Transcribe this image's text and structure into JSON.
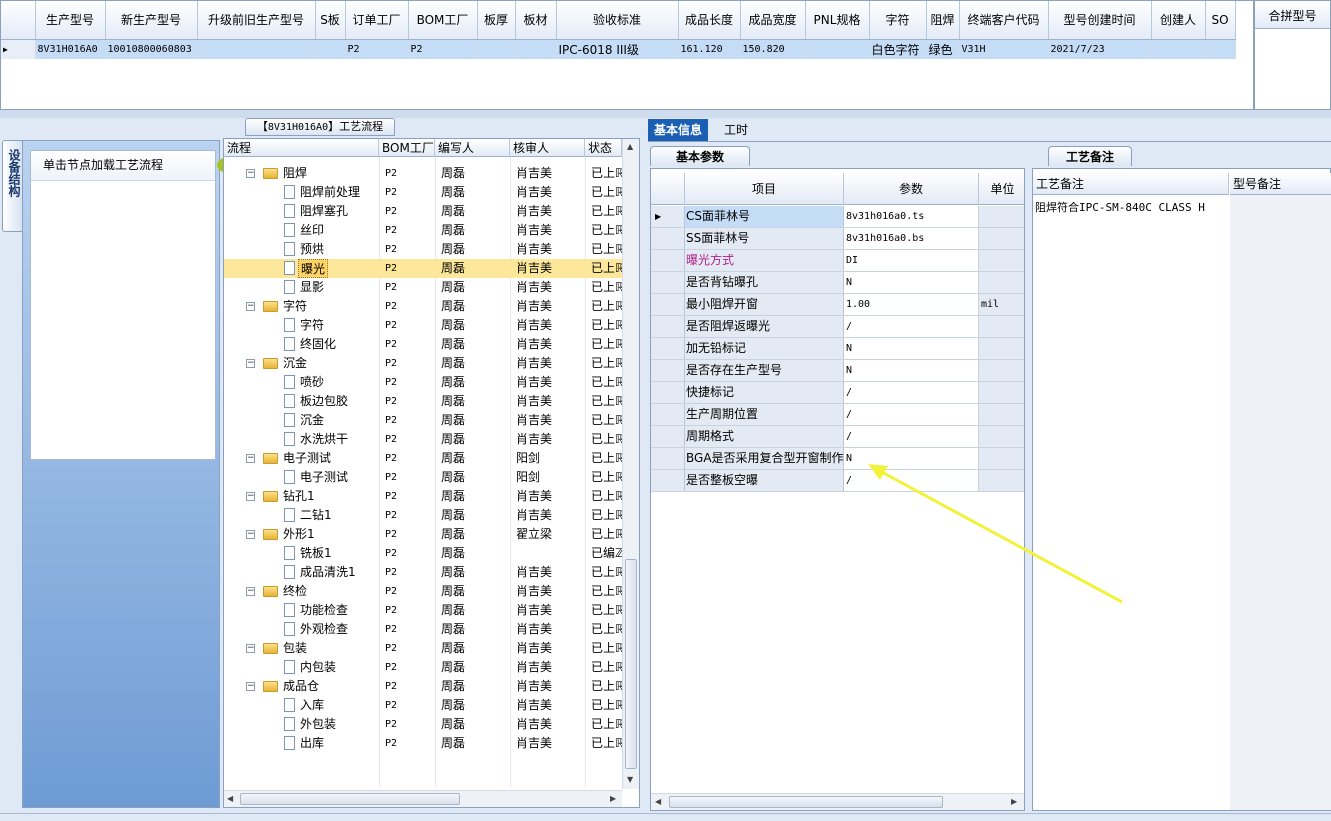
{
  "top_grid": {
    "headers": [
      "生产型号",
      "新生产型号",
      "升级前旧生产型号",
      "S板",
      "订单工厂",
      "BOM工厂",
      "板厚",
      "板材",
      "验收标准",
      "成品长度",
      "成品宽度",
      "PNL规格",
      "字符",
      "阻焊",
      "终端客户代码",
      "型号创建时间",
      "创建人",
      "SO"
    ],
    "row": [
      "8V31H016A0",
      "10010800060803",
      "",
      "",
      "P2",
      "P2",
      "",
      "",
      "IPC-6018 III级",
      "161.120",
      "150.820",
      "",
      "白色字符",
      "绿色",
      "V31H",
      "2021/7/23",
      "",
      ""
    ],
    "indicator": "▶"
  },
  "merge_panel": {
    "header": "合拼型号"
  },
  "left": {
    "vertical_tab": "设备结构",
    "load_hint": "单击节点加载工艺流程",
    "process_title_prefix": "【",
    "process_title_code": "8V31H016A0",
    "process_title_suffix": "】工艺流程"
  },
  "tree": {
    "headers": [
      "流程",
      "BOM工厂",
      "编写人",
      "核审人",
      "状态"
    ],
    "rows": [
      {
        "level": 0,
        "name": "阻焊",
        "bom": "P2",
        "writer": "周磊",
        "reviewer": "肖吉美",
        "status": "已上ℝ"
      },
      {
        "level": 1,
        "name": "阻焊前处理",
        "bom": "P2",
        "writer": "周磊",
        "reviewer": "肖吉美",
        "status": "已上ℝ"
      },
      {
        "level": 1,
        "name": "阻焊塞孔",
        "bom": "P2",
        "writer": "周磊",
        "reviewer": "肖吉美",
        "status": "已上ℝ"
      },
      {
        "level": 1,
        "name": "丝印",
        "bom": "P2",
        "writer": "周磊",
        "reviewer": "肖吉美",
        "status": "已上ℝ"
      },
      {
        "level": 1,
        "name": "预烘",
        "bom": "P2",
        "writer": "周磊",
        "reviewer": "肖吉美",
        "status": "已上ℝ"
      },
      {
        "level": 1,
        "name": "曝光",
        "bom": "P2",
        "writer": "周磊",
        "reviewer": "肖吉美",
        "status": "已上ℝ",
        "selected": true
      },
      {
        "level": 1,
        "name": "显影",
        "bom": "P2",
        "writer": "周磊",
        "reviewer": "肖吉美",
        "status": "已上ℝ"
      },
      {
        "level": 0,
        "name": "字符",
        "bom": "P2",
        "writer": "周磊",
        "reviewer": "肖吉美",
        "status": "已上ℝ"
      },
      {
        "level": 1,
        "name": "字符",
        "bom": "P2",
        "writer": "周磊",
        "reviewer": "肖吉美",
        "status": "已上ℝ"
      },
      {
        "level": 1,
        "name": "终固化",
        "bom": "P2",
        "writer": "周磊",
        "reviewer": "肖吉美",
        "status": "已上ℝ"
      },
      {
        "level": 0,
        "name": "沉金",
        "bom": "P2",
        "writer": "周磊",
        "reviewer": "肖吉美",
        "status": "已上ℝ"
      },
      {
        "level": 1,
        "name": "喷砂",
        "bom": "P2",
        "writer": "周磊",
        "reviewer": "肖吉美",
        "status": "已上ℝ"
      },
      {
        "level": 1,
        "name": "板边包胶",
        "bom": "P2",
        "writer": "周磊",
        "reviewer": "肖吉美",
        "status": "已上ℝ"
      },
      {
        "level": 1,
        "name": "沉金",
        "bom": "P2",
        "writer": "周磊",
        "reviewer": "肖吉美",
        "status": "已上ℝ"
      },
      {
        "level": 1,
        "name": "水洗烘干",
        "bom": "P2",
        "writer": "周磊",
        "reviewer": "肖吉美",
        "status": "已上ℝ"
      },
      {
        "level": 0,
        "name": "电子测试",
        "bom": "P2",
        "writer": "周磊",
        "reviewer": "阳剑",
        "status": "已上ℝ"
      },
      {
        "level": 1,
        "name": "电子测试",
        "bom": "P2",
        "writer": "周磊",
        "reviewer": "阳剑",
        "status": "已上ℝ"
      },
      {
        "level": 0,
        "name": "钻孔1",
        "bom": "P2",
        "writer": "周磊",
        "reviewer": "肖吉美",
        "status": "已上ℝ"
      },
      {
        "level": 1,
        "name": "二钻1",
        "bom": "P2",
        "writer": "周磊",
        "reviewer": "肖吉美",
        "status": "已上ℝ"
      },
      {
        "level": 0,
        "name": "外形1",
        "bom": "P2",
        "writer": "周磊",
        "reviewer": "翟立梁",
        "status": "已上ℝ"
      },
      {
        "level": 1,
        "name": "铣板1",
        "bom": "P2",
        "writer": "周磊",
        "reviewer": "",
        "status": "已编ℤ"
      },
      {
        "level": 1,
        "name": "成品清洗1",
        "bom": "P2",
        "writer": "周磊",
        "reviewer": "肖吉美",
        "status": "已上ℝ"
      },
      {
        "level": 0,
        "name": "终检",
        "bom": "P2",
        "writer": "周磊",
        "reviewer": "肖吉美",
        "status": "已上ℝ"
      },
      {
        "level": 1,
        "name": "功能检查",
        "bom": "P2",
        "writer": "周磊",
        "reviewer": "肖吉美",
        "status": "已上ℝ"
      },
      {
        "level": 1,
        "name": "外观检查",
        "bom": "P2",
        "writer": "周磊",
        "reviewer": "肖吉美",
        "status": "已上ℝ"
      },
      {
        "level": 0,
        "name": "包装",
        "bom": "P2",
        "writer": "周磊",
        "reviewer": "肖吉美",
        "status": "已上ℝ"
      },
      {
        "level": 1,
        "name": "内包装",
        "bom": "P2",
        "writer": "周磊",
        "reviewer": "肖吉美",
        "status": "已上ℝ"
      },
      {
        "level": 0,
        "name": "成品仓",
        "bom": "P2",
        "writer": "周磊",
        "reviewer": "肖吉美",
        "status": "已上ℝ"
      },
      {
        "level": 1,
        "name": "入库",
        "bom": "P2",
        "writer": "周磊",
        "reviewer": "肖吉美",
        "status": "已上ℝ"
      },
      {
        "level": 1,
        "name": "外包装",
        "bom": "P2",
        "writer": "周磊",
        "reviewer": "肖吉美",
        "status": "已上ℝ"
      },
      {
        "level": 1,
        "name": "出库",
        "bom": "P2",
        "writer": "周磊",
        "reviewer": "肖吉美",
        "status": "已上ℝ"
      }
    ]
  },
  "right": {
    "tabs": [
      "基本信息",
      "工时"
    ],
    "params_tab": "基本参数",
    "params_headers": [
      "项目",
      "参数",
      "单位"
    ],
    "params": [
      {
        "item": "CS面菲林号",
        "value": "8v31h016a0.ts",
        "unit": "",
        "current": true
      },
      {
        "item": "SS面菲林号",
        "value": "8v31h016a0.bs",
        "unit": ""
      },
      {
        "item": "曝光方式",
        "value": "DI",
        "unit": "",
        "color": "#b0208a"
      },
      {
        "item": "是否背钻曝孔",
        "value": "N",
        "unit": ""
      },
      {
        "item": "最小阻焊开窗",
        "value": "1.00",
        "unit": "mil"
      },
      {
        "item": "是否阻焊返曝光",
        "value": "/",
        "unit": ""
      },
      {
        "item": "加无铅标记",
        "value": "N",
        "unit": ""
      },
      {
        "item": "是否存在生产型号",
        "value": "N",
        "unit": ""
      },
      {
        "item": "快捷标记",
        "value": "/",
        "unit": ""
      },
      {
        "item": "生产周期位置",
        "value": "/",
        "unit": ""
      },
      {
        "item": "周期格式",
        "value": "/",
        "unit": ""
      },
      {
        "item": "BGA是否采用复合型开窗制作",
        "value": "N",
        "unit": ""
      },
      {
        "item": "是否整板空曝",
        "value": "/",
        "unit": ""
      }
    ],
    "notes_tab": "工艺备注",
    "notes_headers": [
      "工艺备注",
      "型号备注"
    ],
    "notes_value": "阻焊符合IPC-SM-840C CLASS H"
  },
  "colors": {
    "accent": "#1a5fb4",
    "selection": "#c5dcf7",
    "tree_selection": "#fde79a",
    "arrow": "#f2f23a"
  }
}
